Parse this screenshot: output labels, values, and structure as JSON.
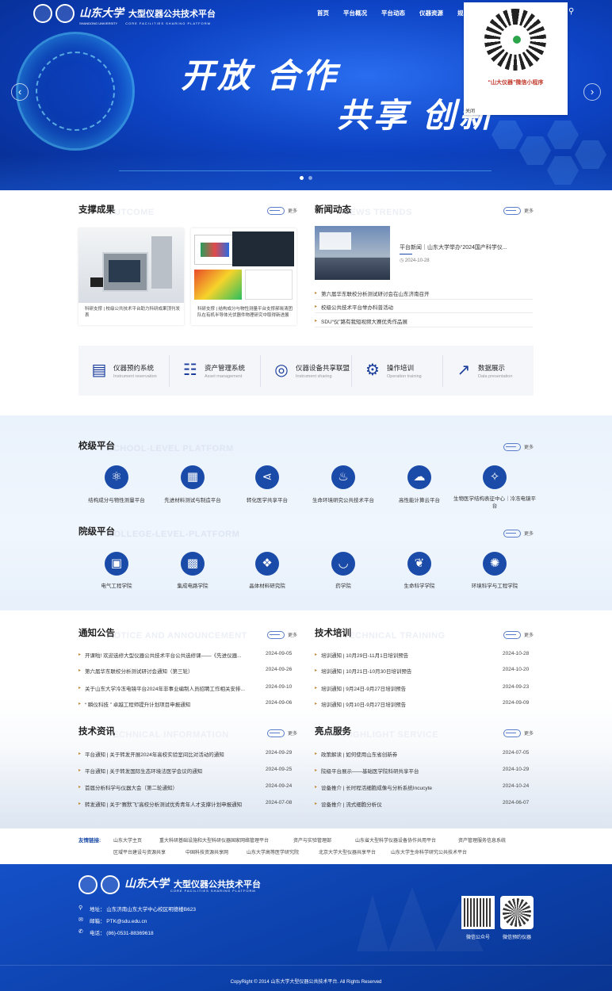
{
  "header": {
    "logo_cn": "山东大学",
    "logo_sub": "SHANDONG UNIVERSITY",
    "platform_cn": "大型仪器公共技术平台",
    "platform_en": "CORE FACILITIES SHARING PLATFORM",
    "nav": [
      "首页",
      "平台概况",
      "平台动态",
      "仪器资源",
      "规"
    ],
    "search_icon": "search-icon"
  },
  "hero": {
    "slogan_line1": "开放 合作",
    "slogan_line2": "共享 创新",
    "prev": "‹",
    "next": "›"
  },
  "mini_program_popup": {
    "caption": "“山大仪器”微信小程序",
    "close_label": "关闭"
  },
  "support": {
    "title": "支撑成果",
    "ghost": "OUTCOME",
    "more": "更多",
    "cards": [
      {
        "caption": "科研支撑 | 校级公共技术平台助力科研成果顶刊发表"
      },
      {
        "caption": "科研支撑 | 结构成分与物性测量平台支撑郝晓清团队在有机半导体光伏器件物理研究中取得新进展"
      }
    ]
  },
  "news": {
    "title": "新闻动态",
    "ghost": "NEWS TRENDS",
    "more": "更多",
    "featured": {
      "title": "平台新闻｜山东大学举办“2024国产科学仪...",
      "date": "2024-10-28"
    },
    "items": [
      "第六届华东联校分析测试研讨会在山东济南召开",
      "校级公共技术平台举办科普活动",
      "SDU“仪”路有我短视频大赛优秀作品展"
    ]
  },
  "systems": [
    {
      "name": "仪器预约系统",
      "en": "Instrument reservation",
      "icon": "monitor-chart-icon"
    },
    {
      "name": "资产管理系统",
      "en": "Asset management",
      "icon": "coin-stack-icon"
    },
    {
      "name": "仪器设备共享联盟",
      "en": "Instrument sharing",
      "icon": "trend-circle-icon"
    },
    {
      "name": "操作培训",
      "en": "Operation training",
      "icon": "gear-screen-icon"
    },
    {
      "name": "数据展示",
      "en": "Data presentation",
      "icon": "line-chart-icon"
    }
  ],
  "school_platform": {
    "title": "校级平台",
    "ghost": "SCHOOL-LEVEL PLATFORM",
    "more": "更多",
    "items": [
      {
        "label": "结构成分与物性测量平台",
        "icon": "molecule-icon"
      },
      {
        "label": "先进材料测试与制造平台",
        "icon": "chart-board-icon"
      },
      {
        "label": "转化医学共享平台",
        "icon": "share-icon"
      },
      {
        "label": "生命环境研究公共技术平台",
        "icon": "drop-hand-icon"
      },
      {
        "label": "高性能计算云平台",
        "icon": "cloud-server-icon"
      },
      {
        "label": "生物医学结构表征中心｜冷冻电镜平台",
        "icon": "microscope-icon"
      }
    ]
  },
  "college_platform": {
    "title": "院级平台",
    "ghost": "COLLEGE-LEVEL-PLATFORM",
    "more": "更多",
    "items": [
      {
        "label": "电气工程学院",
        "icon": "battery-icon"
      },
      {
        "label": "集成电路学院",
        "icon": "chip-icon"
      },
      {
        "label": "晶体材料研究院",
        "icon": "crystal-icon"
      },
      {
        "label": "药学院",
        "icon": "mortar-icon"
      },
      {
        "label": "生命科学学院",
        "icon": "leaf-icon"
      },
      {
        "label": "环境科学与工程学院",
        "icon": "atom-icon"
      }
    ]
  },
  "notices": {
    "title": "通知公告",
    "ghost": "NOTICE AND ANNOUNCEMENT",
    "more": "更多",
    "items": [
      {
        "text": "开课啦! 欢迎选修大型仪器公共技术平台公共选修课——《先进仪器...",
        "date": "2024-09-05"
      },
      {
        "text": "第六届华东联校分析测试研讨会通知（第三轮）",
        "date": "2024-09-26"
      },
      {
        "text": "关于山东大学冷冻电镜平台2024年非事业编制人员招聘工作相关安排...",
        "date": "2024-09-10"
      },
      {
        "text": "“ 瞬仪科技 ” 卓越工程师提升计划项目申报通知",
        "date": "2024-09-06"
      }
    ]
  },
  "training": {
    "title": "技术培训",
    "ghost": "TECHNICAL TRAINING",
    "more": "更多",
    "items": [
      {
        "text": "培训通知 | 10月29日-11月1日培训预告",
        "date": "2024-10-28"
      },
      {
        "text": "培训通知 | 10月21日-10月30日培训预告",
        "date": "2024-10-20"
      },
      {
        "text": "培训通知 | 9月24日-9月27日培训预告",
        "date": "2024-09-23"
      },
      {
        "text": "培训通知 | 9月10日-9月27日培训预告",
        "date": "2024-09-09"
      }
    ]
  },
  "tech_info": {
    "title": "技术资讯",
    "ghost": "TECHNICAL INFORMATION",
    "more": "更多",
    "items": [
      {
        "text": "平台通知 | 关于转发开展2024年高校实验室间比对活动的通知",
        "date": "2024-09-29"
      },
      {
        "text": "平台通知 | 关于转发国际生态环境法医学会议的通知",
        "date": "2024-09-25"
      },
      {
        "text": "首届分析科学与仪器大会（第二轮通知）",
        "date": "2024-09-24"
      },
      {
        "text": "转发通知 | 关于“赛默飞”高校分析测试优秀青年人才支撑计划申报通知",
        "date": "2024-07-08"
      }
    ]
  },
  "highlights": {
    "title": "亮点服务",
    "ghost": "HIGHLIGHT SERVICE",
    "more": "更多",
    "items": [
      {
        "text": "政策解读 | 如何使用山东省创新券",
        "date": "2024-07-05"
      },
      {
        "text": "院级平台展示——基础医学院科研共享平台",
        "date": "2024-10-29"
      },
      {
        "text": "设备推介 | 长时程活细胞成像与分析系统Incucyte",
        "date": "2024-10-24"
      },
      {
        "text": "设备推介 | 流式细胞分析仪",
        "date": "2024-06-07"
      }
    ]
  },
  "friend_links": {
    "label": "友情链接:",
    "row1": [
      "山东大学主页",
      "重大科研基础设施和大型科研仪器国家网络管理平台",
      "资产与实验管理部",
      "山东省大型科学仪器设备协作共用平台",
      "资产管理服务信息系统"
    ],
    "row2": [
      "区域平台建设与资源共享",
      "中国科技资源共享网",
      "山东大学高等医学研究院",
      "北京大学大型仪器共享平台",
      "山东大学生命科学研究公共技术平台"
    ]
  },
  "footer": {
    "logo_cn": "山东大学",
    "platform_cn": "大型仪器公共技术平台",
    "platform_en": "CORE FACILITIES SHARING PLATFORM",
    "address": "地址：  山东济南山东大学中心校区明德楼B623",
    "email": "邮箱：  PTK@sdu.edu.cn",
    "phone": "电话：  (86)-0531-88369618",
    "qr1_caption": "微信公众号",
    "qr2_caption": "微信预约仪器",
    "copyright": "CopyRight © 2014 山东大学大型仪器公共技术平台. All Rights Reserved"
  },
  "colors": {
    "primary": "#1a4ba8",
    "hero_bg": "#0d43c4",
    "footer_bg": "#0b3fa8",
    "accent_red": "#c0392b"
  }
}
